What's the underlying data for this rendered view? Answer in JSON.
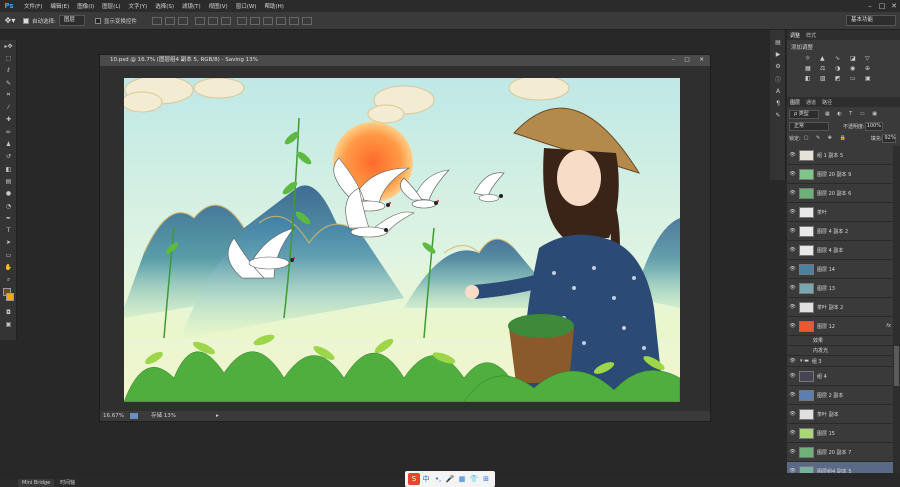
{
  "app": {
    "logo": "Ps",
    "minimize": "–",
    "restore": "□",
    "close": "✕"
  },
  "menu": [
    "文件(F)",
    "编辑(E)",
    "图像(I)",
    "图层(L)",
    "文字(Y)",
    "选择(S)",
    "滤镜(T)",
    "视图(V)",
    "窗口(W)",
    "帮助(H)"
  ],
  "options": {
    "tool_icon": "move-tool-icon",
    "auto_select_label": "自动选择:",
    "auto_select_value": "图层",
    "show_transform_label": "显示变换控件",
    "workspace": "基本功能"
  },
  "document": {
    "title": "10.psd @ 16.7% (图层组4 副本 5, RGB/8) - Saving 13%",
    "zoom": "16.67%",
    "status": "存储 13%"
  },
  "adjustments": {
    "tab1": "调整",
    "tab2": "样式",
    "title": "添加调整"
  },
  "layers_panel": {
    "tabs": [
      "图层",
      "通道",
      "路径"
    ],
    "kind": "ρ 类型",
    "blend_mode": "正常",
    "opacity_label": "不透明度:",
    "opacity_value": "100%",
    "lock_label": "锁定:",
    "fill_label": "填充:",
    "fill_value": "92%",
    "layers": [
      {
        "name": "组 1 副本 5",
        "thumb": "#e6e2d8"
      },
      {
        "name": "图层 20 副本 9",
        "thumb": "#7fc48a"
      },
      {
        "name": "图层 20 副本 6",
        "thumb": "#6fb079"
      },
      {
        "name": "茶叶",
        "thumb": "#e8e8e8"
      },
      {
        "name": "图层 4 副本 2",
        "thumb": "#e8e8e8"
      },
      {
        "name": "图层 4 副本",
        "thumb": "#e8e8e8"
      },
      {
        "name": "图层 14",
        "thumb": "#4f7fa0"
      },
      {
        "name": "图层 13",
        "thumb": "#7aa6b0"
      },
      {
        "name": "茶叶 副本 2",
        "thumb": "#e0e0e0"
      },
      {
        "name": "图层 12",
        "thumb": "#e85a2a",
        "fx": "fx"
      },
      {
        "name": "效果",
        "sub": true
      },
      {
        "name": "内发光",
        "sub": true
      },
      {
        "name": "组 3",
        "group": true
      },
      {
        "name": "组 4",
        "thumb": "#445"
      },
      {
        "name": "图层 2 副本",
        "thumb": "#5a7fb0"
      },
      {
        "name": "茶叶 副本",
        "thumb": "#e0e0e0"
      },
      {
        "name": "图层 15",
        "thumb": "#a9d67a"
      },
      {
        "name": "图层 20 副本 7",
        "thumb": "#6fb079"
      },
      {
        "name": "图层组4 副本 5",
        "thumb": "#7ab0a0",
        "selected": true
      },
      {
        "name": "图层 13 副本",
        "thumb": "#7aa6b0"
      }
    ]
  },
  "bottom": {
    "mini_bridge": "Mini Bridge",
    "timeline": "时间轴"
  },
  "taskbar": [
    "S",
    "中",
    "•,",
    "🎤",
    "▦",
    "👕",
    "⊞"
  ]
}
